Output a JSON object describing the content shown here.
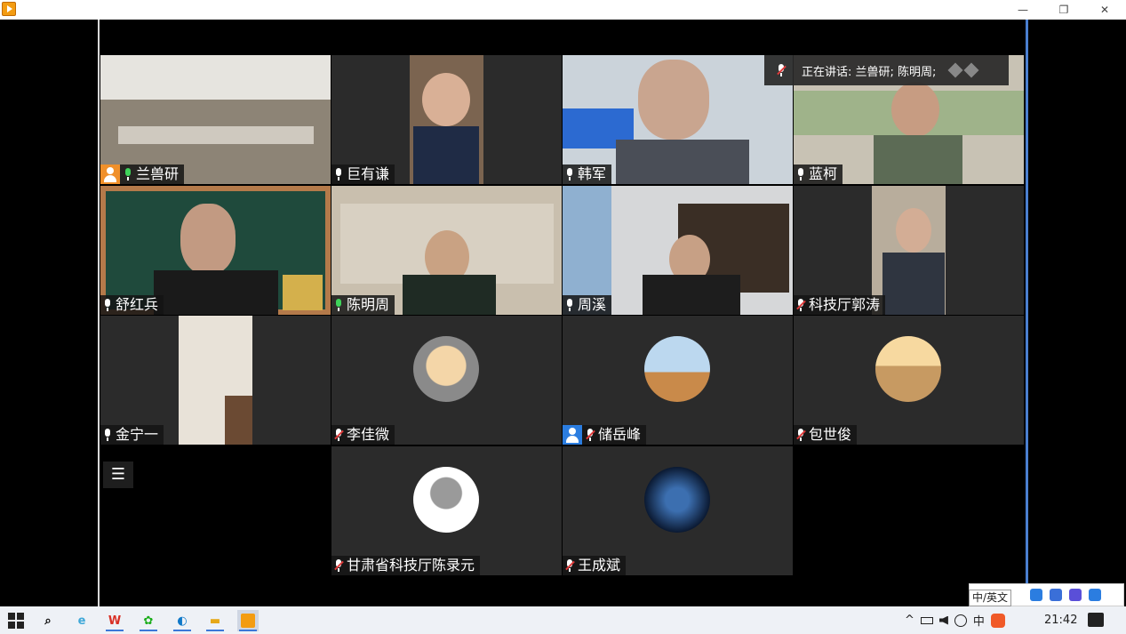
{
  "window": {
    "minimize_glyph": "—",
    "restore_glyph": "❐",
    "close_glyph": "✕"
  },
  "speaking": {
    "text": "正在讲话: 兰兽研; 陈明周;"
  },
  "participants": [
    {
      "name": "兰兽研",
      "mic": "active",
      "badge": "host-orange"
    },
    {
      "name": "巨有谦",
      "mic": "on"
    },
    {
      "name": "韩军",
      "mic": "on"
    },
    {
      "name": "蓝柯",
      "mic": "on"
    },
    {
      "name": "舒红兵",
      "mic": "on"
    },
    {
      "name": "陈明周",
      "mic": "active"
    },
    {
      "name": "周溪",
      "mic": "on"
    },
    {
      "name": "科技厅郭涛",
      "mic": "muted"
    },
    {
      "name": "金宁一",
      "mic": "on"
    },
    {
      "name": "李佳微",
      "mic": "muted"
    },
    {
      "name": "储岳峰",
      "mic": "muted",
      "badge": "host-blue"
    },
    {
      "name": "包世俊",
      "mic": "muted"
    },
    {
      "name": "甘肃省科技厅陈录元",
      "mic": "muted"
    },
    {
      "name": "王成斌",
      "mic": "muted"
    }
  ],
  "taskbar": {
    "search_glyph": "⌕",
    "ie_glyph": "e",
    "wps_glyph": "W",
    "wechat_glyph": "✿",
    "edge_glyph": "◐",
    "explorer_glyph": "▬",
    "tray_up": "^",
    "tray_ime": "中",
    "clock": "21:42"
  },
  "ime": {
    "tooltip": "中/英文"
  },
  "list_glyph": "☰"
}
